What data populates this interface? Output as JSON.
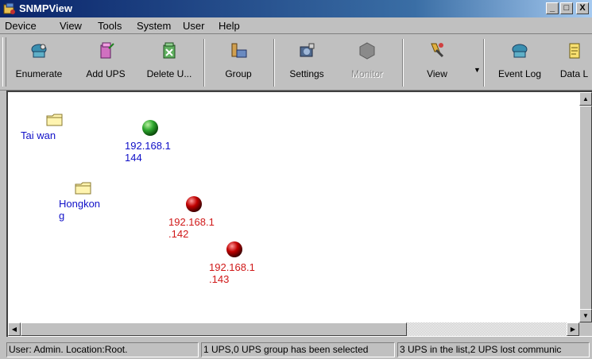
{
  "window": {
    "title": "SNMPView",
    "minimize": "_",
    "maximize": "□",
    "close": "X"
  },
  "menu": [
    "Device",
    "View",
    "Tools",
    "System",
    "User",
    "Help"
  ],
  "toolbar": {
    "enumerate": "Enumerate",
    "add_ups": "Add UPS",
    "delete_ups": "Delete U...",
    "group": "Group",
    "settings": "Settings",
    "monitor": "Monitor",
    "view": "View",
    "event_log": "Event Log",
    "data_log": "Data L"
  },
  "nodes": {
    "folder_taiwan": "Tai wan",
    "ups_144": "192.168.1\n144",
    "folder_hongkong": "Hongkon\ng",
    "ups_142": "192.168.1\n.142",
    "ups_143": "192.168.1\n.143"
  },
  "status": {
    "location": "User: Admin.  Location:Root.",
    "selection": "1 UPS,0 UPS group has been selected",
    "list": "3 UPS in the list,2 UPS  lost communic"
  },
  "colors": {
    "online": "#2fa82f",
    "lost": "#c00000",
    "label_online": "#1010c8",
    "label_lost": "#d01818"
  }
}
